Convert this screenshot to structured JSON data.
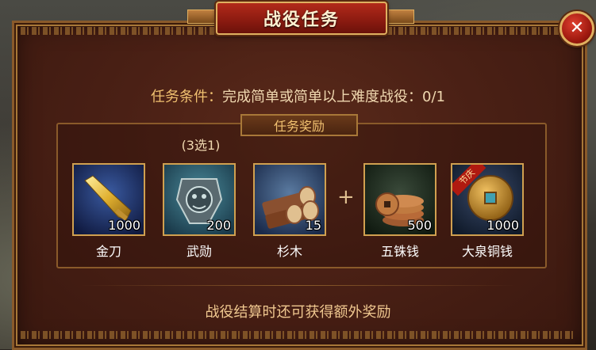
{
  "window": {
    "title": "战役任务"
  },
  "close": {
    "glyph": "✕"
  },
  "condition": {
    "label": "任务条件：",
    "text": "完成简单或简单以上难度战役：0/1"
  },
  "rewards": {
    "header": "任务奖励",
    "choose_label": "(3选1)",
    "items": [
      {
        "name": "金刀",
        "qty": "1000",
        "icon": "golden-knife-icon"
      },
      {
        "name": "武勋",
        "qty": "200",
        "icon": "medal-icon"
      },
      {
        "name": "杉木",
        "qty": "15",
        "icon": "wood-logs-icon"
      },
      {
        "name": "五铢钱",
        "qty": "500",
        "icon": "coin-stack-icon"
      },
      {
        "name": "大泉铜钱",
        "qty": "1000",
        "icon": "bronze-coin-icon",
        "badge": "节庆"
      }
    ],
    "plus": "+"
  },
  "footer": "战役结算时还可获得额外奖励",
  "colors": {
    "panel": "#4a2015",
    "gold_border": "#d0a050",
    "title_red": "#8a1a10",
    "label_gold": "#f0c070"
  }
}
